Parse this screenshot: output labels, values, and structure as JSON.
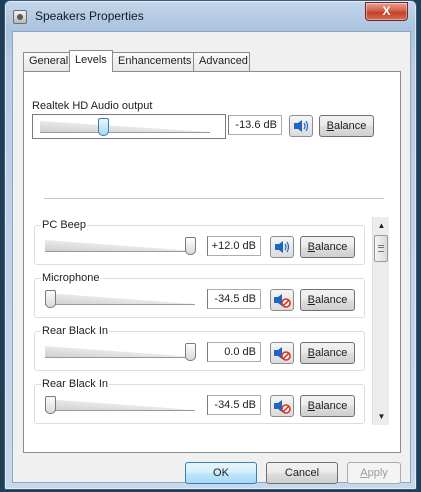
{
  "window": {
    "title": "Speakers Properties",
    "close_glyph": "X"
  },
  "tabs": [
    {
      "label": "General"
    },
    {
      "label": "Levels"
    },
    {
      "label": "Enhancements"
    },
    {
      "label": "Advanced"
    }
  ],
  "active_tab": "Levels",
  "master": {
    "title": "Realtek HD Audio output",
    "value": "-13.6 dB",
    "level": 0.36,
    "muted": false,
    "balance_label_underlined": "B",
    "balance_label_rest": "alance"
  },
  "channels": [
    {
      "title": "PC Beep",
      "value": "+12.0 dB",
      "level": 1.0,
      "muted": false,
      "balance_label_underlined": "B",
      "balance_label_rest": "alance"
    },
    {
      "title": "Microphone",
      "value": "-34.5 dB",
      "level": 0.0,
      "muted": true,
      "balance_label_underlined": "B",
      "balance_label_rest": "alance"
    },
    {
      "title": "Rear Black In",
      "value": "0.0 dB",
      "level": 1.0,
      "muted": true,
      "balance_label_underlined": "B",
      "balance_label_rest": "alance"
    },
    {
      "title": "Rear Black In",
      "value": "-34.5 dB",
      "level": 0.0,
      "muted": true,
      "balance_label_underlined": "B",
      "balance_label_rest": "alance"
    }
  ],
  "footer": {
    "ok_label": "OK",
    "cancel_label": "Cancel",
    "apply_label_underlined": "A",
    "apply_label_rest": "pply"
  },
  "colors": {
    "speaker_blue": "#1f66c4",
    "mute_red": "#d8331f",
    "selected_thumb": "#a6d9f5"
  },
  "icons": {
    "speaker": "speaker-icon",
    "muted_speaker": "muted-speaker-icon",
    "title": "speaker-properties-icon"
  }
}
